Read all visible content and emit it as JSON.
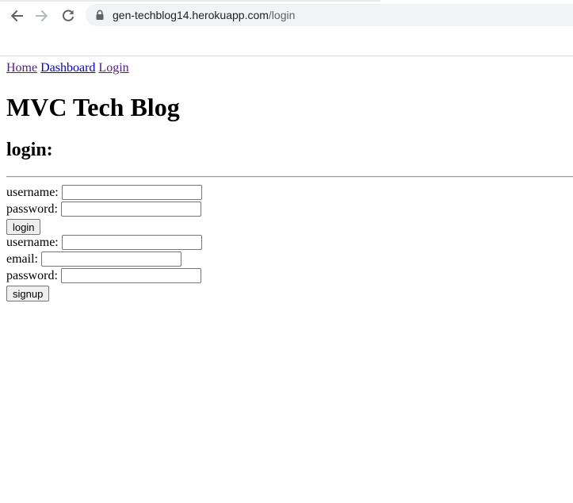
{
  "browser": {
    "url_host": "gen-techblog14.herokuapp.com",
    "url_path": "/login",
    "icons": [
      "back-arrow-icon",
      "forward-arrow-icon",
      "reload-icon",
      "lock-icon"
    ]
  },
  "nav": {
    "links": [
      "Home",
      "Dashboard",
      "Login"
    ]
  },
  "site_title": "MVC Tech Blog",
  "section_title": "login:",
  "login_form": {
    "username_label": "username:",
    "username_value": "",
    "password_label": "password:",
    "password_value": "",
    "submit_label": "login"
  },
  "signup_form": {
    "username_label": "username:",
    "username_value": "",
    "email_label": "email:",
    "email_value": "",
    "password_label": "password:",
    "password_value": "",
    "submit_label": "signup"
  },
  "colors": {
    "visited_link": "#551a8b",
    "unvisited_link": "#0000ee",
    "omnibox_bg": "#f1f3f4"
  }
}
